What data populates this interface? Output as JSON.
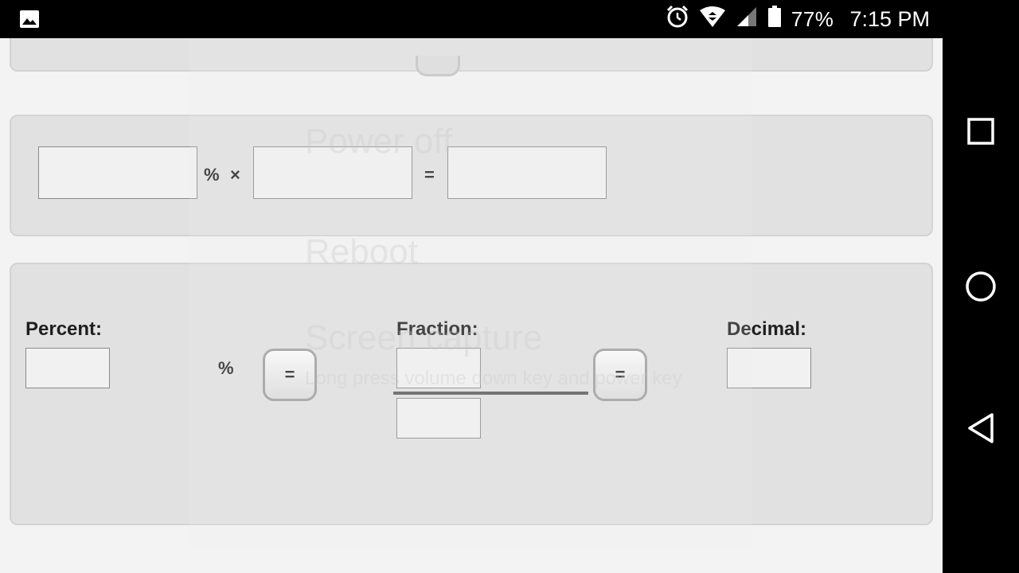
{
  "status_bar": {
    "battery_percent": "77%",
    "time": "7:15 PM",
    "icons": [
      "image-notification-icon",
      "alarm-icon",
      "wifi-icon",
      "cell-signal-icon",
      "battery-icon"
    ]
  },
  "navigation_bar": {
    "buttons": [
      "recents-square-icon",
      "home-circle-icon",
      "back-triangle-icon"
    ]
  },
  "percent_of_panel": {
    "percent_value": "",
    "percent_symbol": "%",
    "times_symbol": "×",
    "number_value": "",
    "equals_symbol": "=",
    "result_value": ""
  },
  "convert_panel": {
    "percent_label": "Percent:",
    "percent_value": "",
    "percent_symbol": "%",
    "equals_button_1": "=",
    "fraction_label": "Fraction:",
    "numerator_value": "",
    "denominator_value": "",
    "equals_button_2": "=",
    "decimal_label": "Decimal:",
    "decimal_value": ""
  },
  "background_menu": {
    "items": [
      "Power off",
      "Reboot",
      "Screen capture"
    ],
    "screen_capture_hint": "Long press volume down key and power key"
  },
  "colors": {
    "panel_bg": "#e1e1e1",
    "panel_border": "#d3d3d3",
    "page_bg": "#f3f3f3",
    "system_bars": "#000000"
  }
}
